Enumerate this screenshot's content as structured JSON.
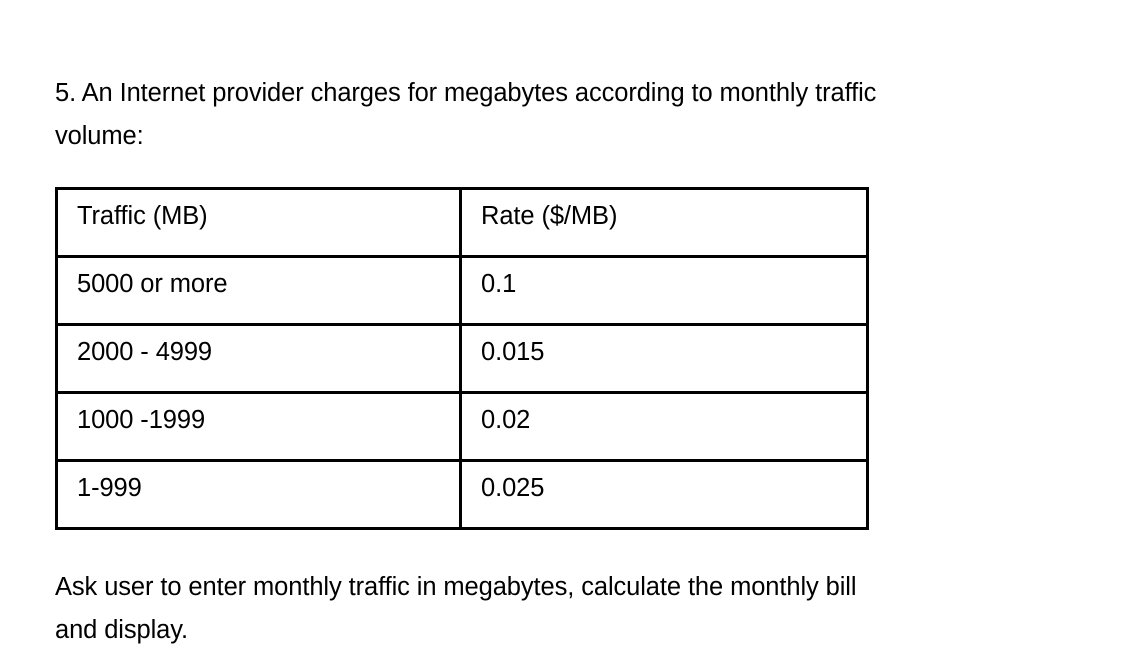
{
  "document": {
    "question_number": "5.",
    "prompt_lines": [
      "5. An Internet provider charges for megabytes according to monthly traffic",
      "volume:"
    ],
    "closing_lines": [
      "Ask user to enter monthly traffic in megabytes, calculate the monthly bill",
      "and display."
    ],
    "colors": {
      "text": "#000000",
      "background": "#ffffff",
      "table_border": "#000000"
    }
  },
  "table": {
    "headers": [
      "Traffic (MB)",
      "Rate ($/MB)"
    ],
    "rows": [
      {
        "traffic": "5000 or more",
        "rate": "0.1"
      },
      {
        "traffic": "2000 - 4999",
        "rate": "0.015"
      },
      {
        "traffic": "1000 -1999",
        "rate": "0.02"
      },
      {
        "traffic": "1-999",
        "rate": "0.025"
      }
    ]
  }
}
